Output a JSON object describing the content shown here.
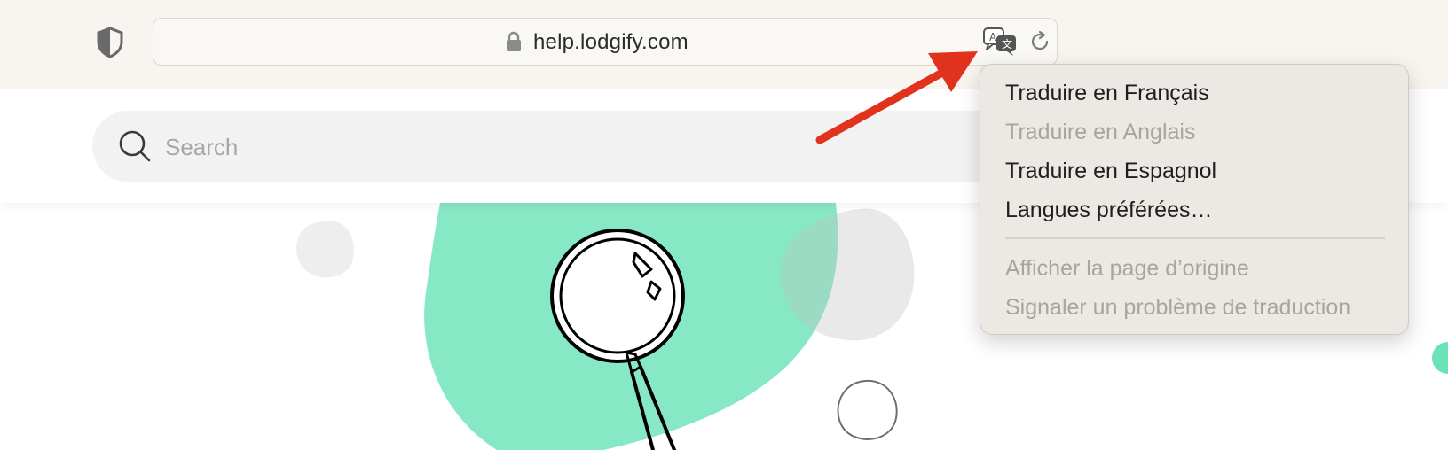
{
  "browser": {
    "url": "help.lodgify.com",
    "icons": {
      "privacy": "shield-half-icon",
      "lock": "lock-icon",
      "translate": "translate-icon",
      "reload": "reload-icon"
    }
  },
  "search": {
    "placeholder": "Search",
    "icon": "search-icon"
  },
  "translate_menu": {
    "items": [
      {
        "label": "Traduire en Français",
        "enabled": true
      },
      {
        "label": "Traduire en Anglais",
        "enabled": false
      },
      {
        "label": "Traduire en Espagnol",
        "enabled": true
      },
      {
        "label": "Langues préférées…",
        "enabled": true
      }
    ],
    "secondary_items": [
      {
        "label": "Afficher la page d’origine",
        "enabled": false
      },
      {
        "label": "Signaler un problème de traduction",
        "enabled": false
      }
    ]
  },
  "colors": {
    "accent_green": "#87e8c5",
    "arrow_red": "#e0321c",
    "toolbar_bg": "#f8f5f0",
    "menu_bg": "#ece8e3"
  }
}
